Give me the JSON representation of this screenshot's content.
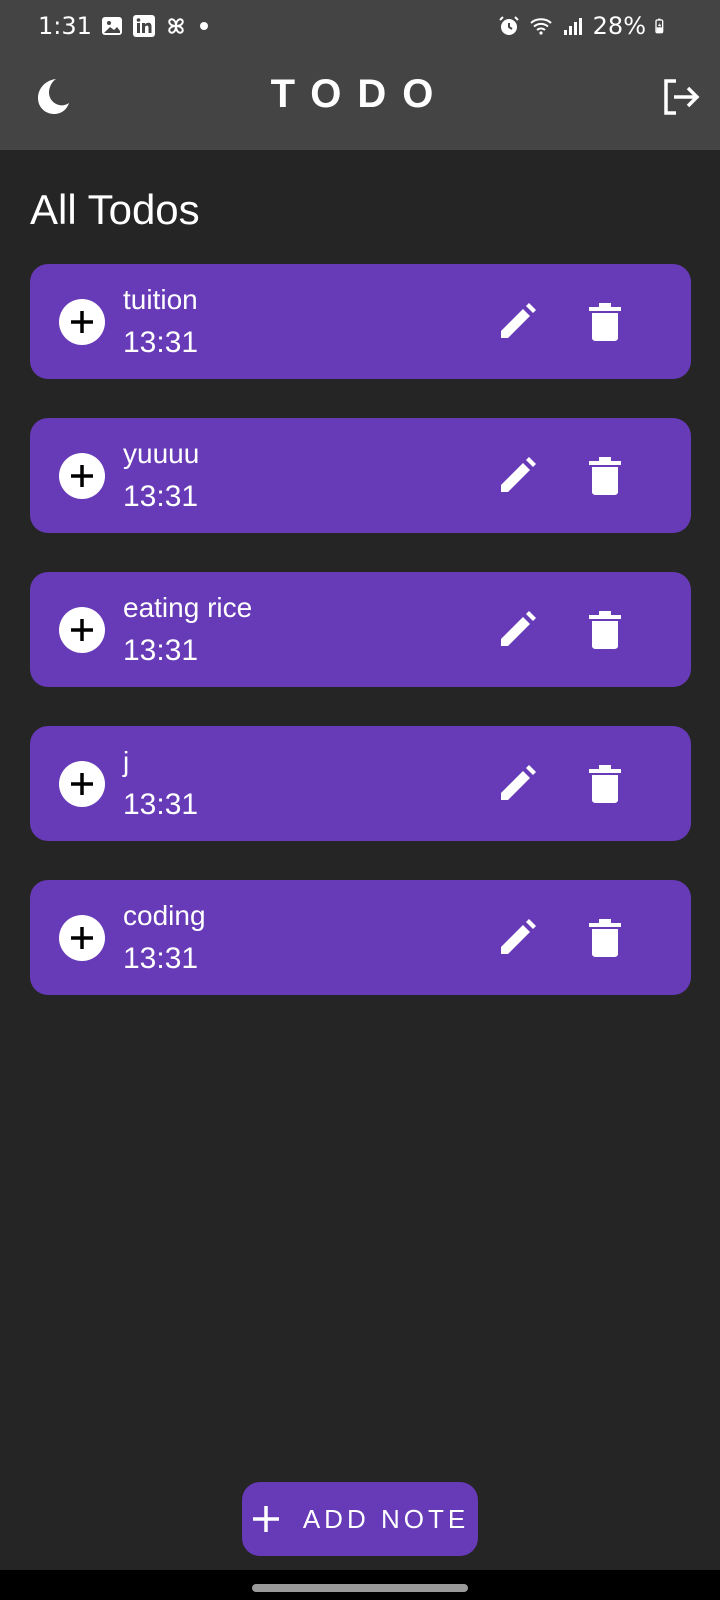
{
  "status_bar": {
    "time": "1:31",
    "battery": "28%"
  },
  "app_bar": {
    "title": "TODO"
  },
  "main": {
    "section_title": "All Todos",
    "todos": [
      {
        "title": "tuition",
        "time": "13:31"
      },
      {
        "title": "yuuuu",
        "time": "13:31"
      },
      {
        "title": "eating rice",
        "time": "13:31"
      },
      {
        "title": "j",
        "time": "13:31"
      },
      {
        "title": "coding",
        "time": "13:31"
      }
    ]
  },
  "fab": {
    "label": "ADD NOTE"
  },
  "colors": {
    "background": "#252525",
    "app_bar": "#444444",
    "card": "#673AB7",
    "text": "#FFFFFF"
  },
  "icons": {
    "theme_toggle": "moon-icon",
    "logout": "logout-icon",
    "add": "plus-circle-icon",
    "edit": "pencil-icon",
    "delete": "trash-icon"
  }
}
